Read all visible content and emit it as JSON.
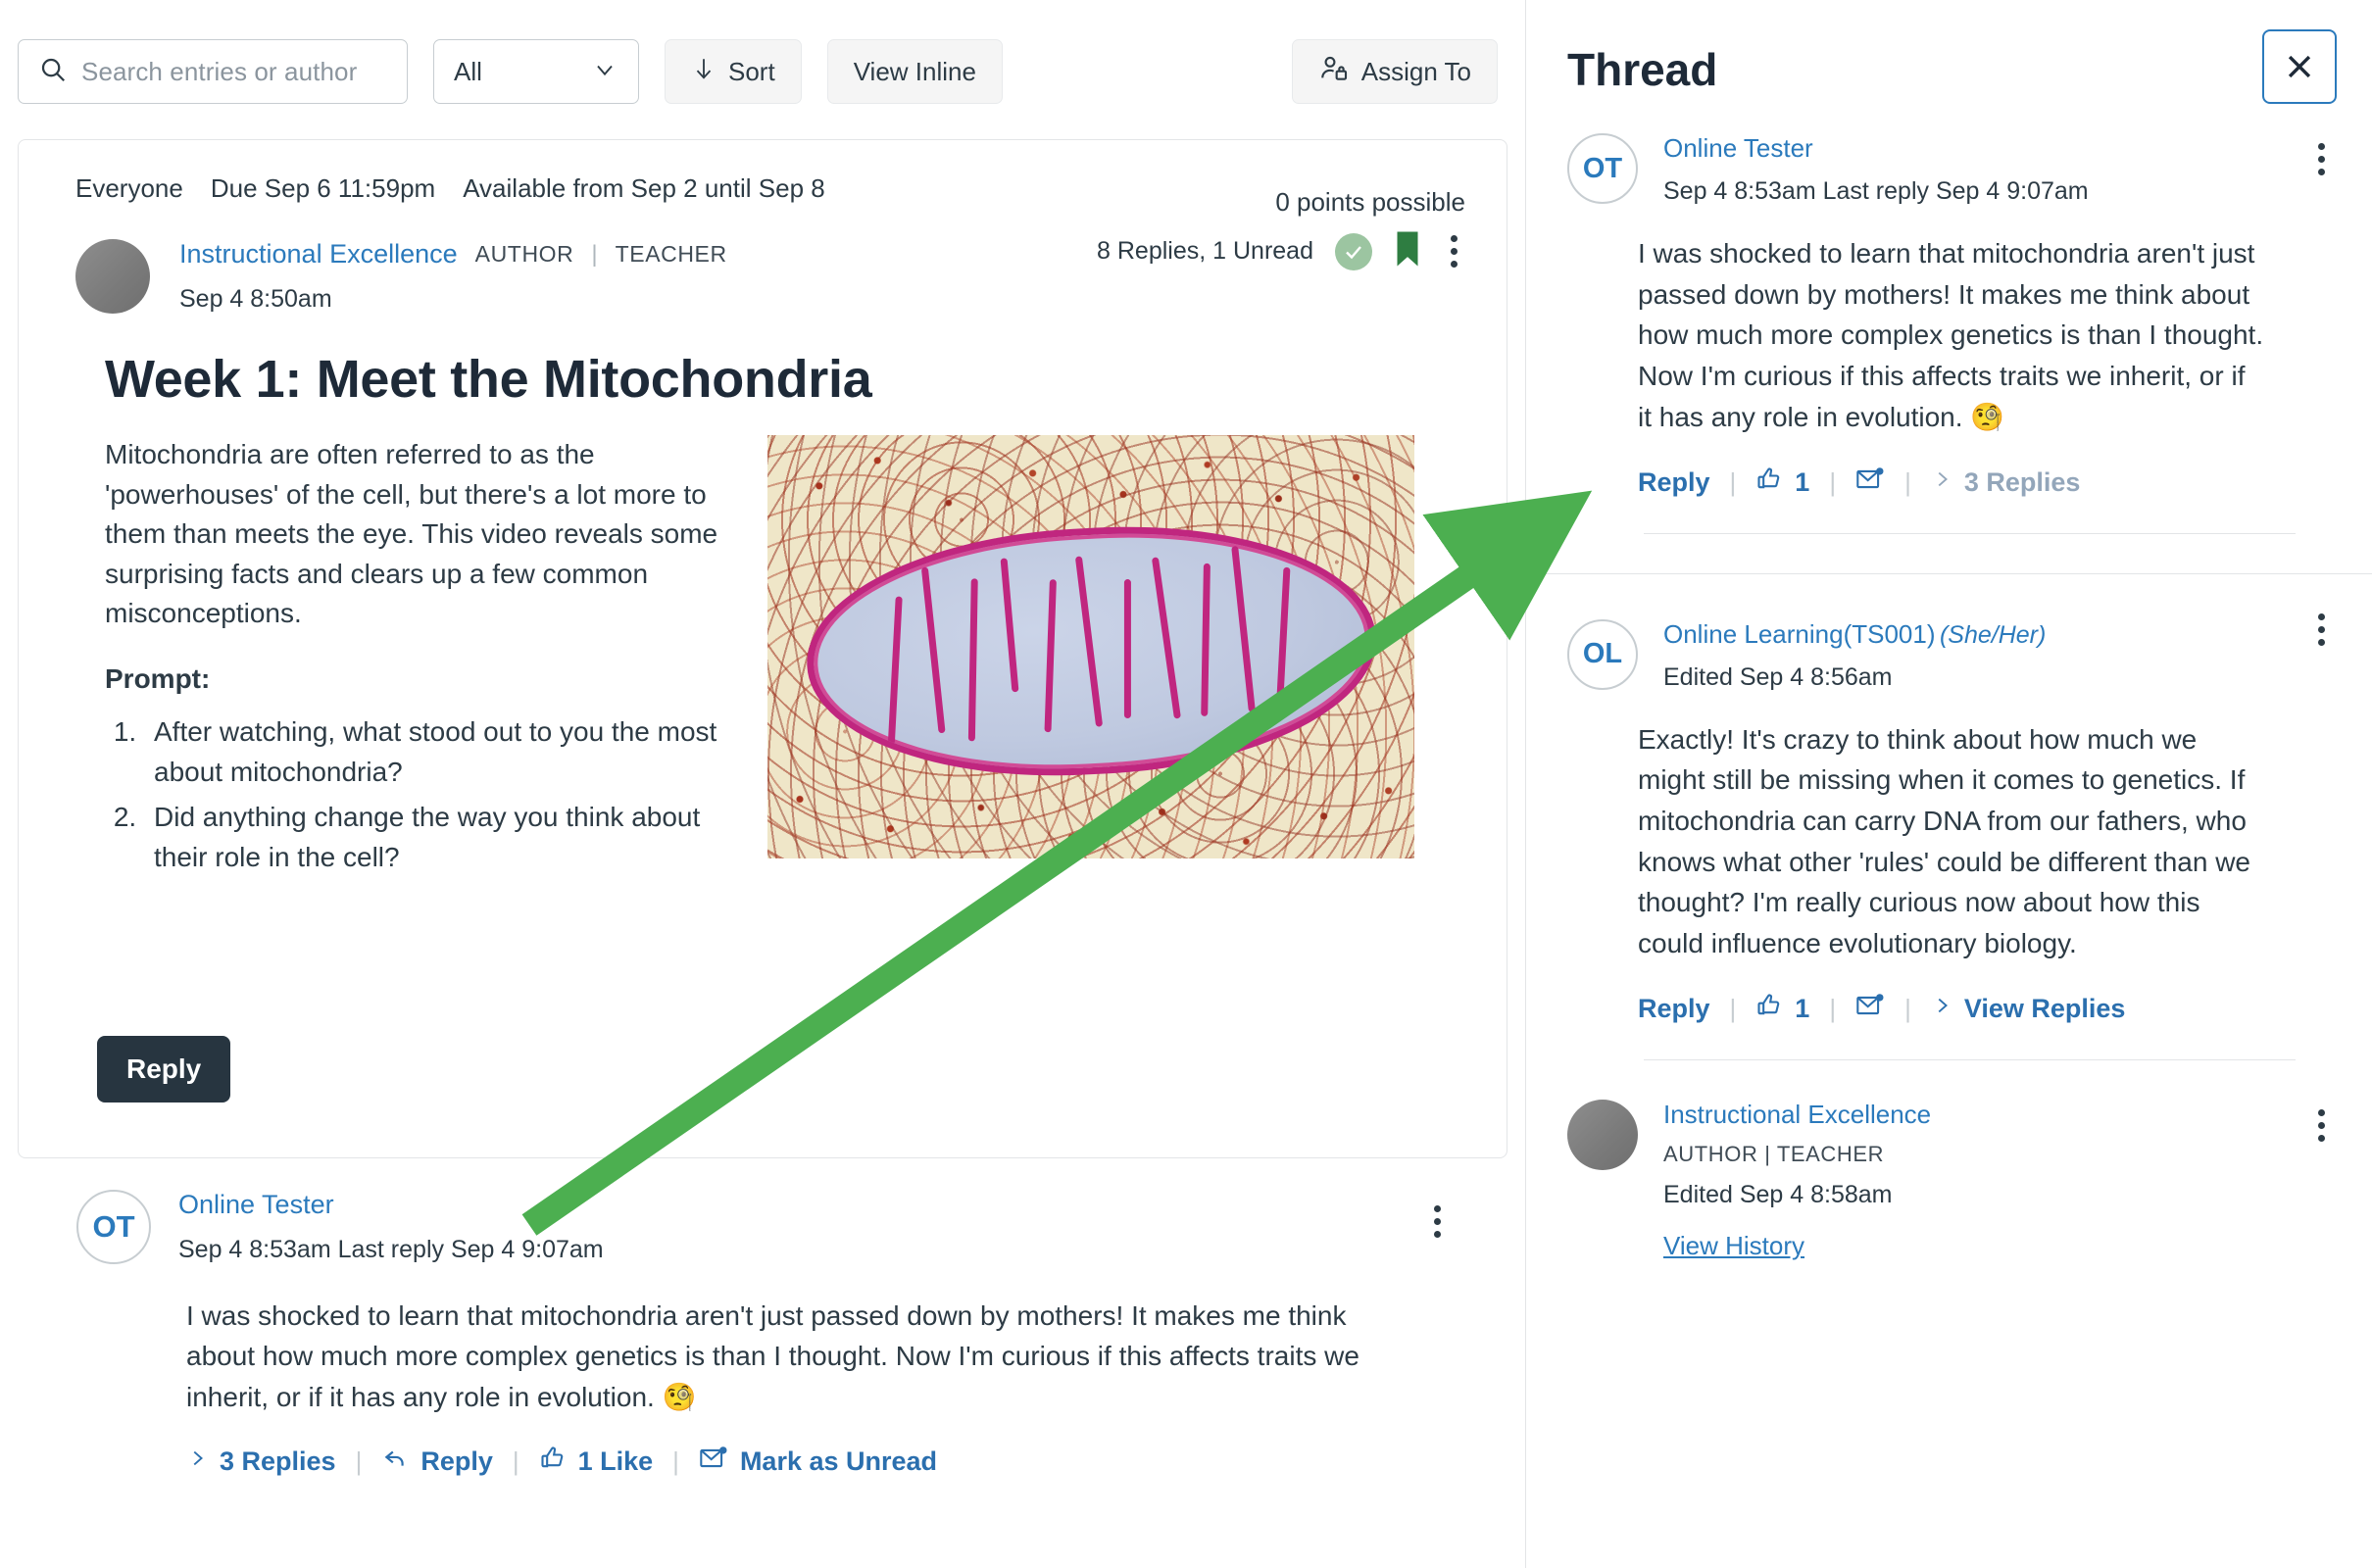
{
  "toolbar": {
    "search_placeholder": "Search entries or author",
    "search_value": "",
    "filter_selected": "All",
    "sort_label": "Sort",
    "view_inline_label": "View Inline",
    "assign_to_label": "Assign To",
    "search_icon": "search-icon",
    "chevron_icon": "chevron-down-icon",
    "sort_icon": "arrow-down-icon",
    "assign_icon": "assign-user-icon"
  },
  "discussion": {
    "audience": "Everyone",
    "due": "Due Sep 6 11:59pm",
    "available": "Available from Sep 2 until Sep 8",
    "points": "0 points possible",
    "author": "Instructional Excellence",
    "author_badge_1": "AUTHOR",
    "author_badge_sep": "|",
    "author_badge_2": "TEACHER",
    "timestamp": "Sep 4 8:50am",
    "replies_summary": "8 Replies, 1 Unread",
    "read_icon": "check-circle-icon",
    "bookmark_icon": "bookmark-icon",
    "kebab_icon": "kebab-menu-icon",
    "title": "Week 1: Meet the Mitochondria",
    "paragraph": "Mitochondria are often referred to as the 'powerhouses' of the cell, but there's a lot more to them than meets the eye. This video reveals some surprising facts and clears up a few common misconceptions.",
    "prompt_label": "Prompt:",
    "prompt_items": [
      "After watching, what stood out to you the most about mitochondria?",
      "Did anything change the way you think about their role in the cell?"
    ],
    "image_alt": "mitochondria-micrograph",
    "reply_button": "Reply"
  },
  "entry": {
    "avatar_initials": "OT",
    "author": "Online Tester",
    "timestamp": "Sep 4 8:53am  Last reply Sep 4 9:07am",
    "text": "I was shocked to learn that mitochondria aren't just passed down by mothers! It makes me think about how much more complex genetics is than I thought. Now I'm curious if this affects traits we inherit, or if it has any role in evolution. 🧐",
    "kebab_icon": "kebab-menu-icon",
    "actions": {
      "replies": "3 Replies",
      "reply": "Reply",
      "like": "1 Like",
      "mark_unread": "Mark as Unread",
      "expand_icon": "chevron-right-icon",
      "reply_icon": "reply-arrow-icon",
      "like_icon": "thumbs-up-icon",
      "unread_icon": "envelope-unread-icon",
      "separator": "|"
    }
  },
  "thread": {
    "title": "Thread",
    "close_icon": "close-icon",
    "posts": [
      {
        "avatar_initials": "OT",
        "avatar_type": "initials",
        "author": "Online Tester",
        "pronouns": "",
        "badges": "",
        "timestamp": "Sep 4 8:53am  Last reply Sep 4 9:07am",
        "view_history": "",
        "text": "I was shocked to learn that mitochondria aren't just passed down by mothers! It makes me think about how much more complex genetics is than I thought. Now I'm curious if this affects traits we inherit, or if it has any role in evolution. 🧐",
        "reply_label": "Reply",
        "like_count": "1",
        "replies_label": "3 Replies",
        "replies_muted": true,
        "kebab_icon": "kebab-menu-icon",
        "like_icon": "thumbs-up-icon",
        "unread_icon": "envelope-unread-icon",
        "expand_icon": "chevron-right-icon",
        "separator": "|"
      },
      {
        "avatar_initials": "OL",
        "avatar_type": "initials",
        "author": "Online Learning(TS001)",
        "pronouns": "(She/Her)",
        "badges": "",
        "timestamp": "Edited Sep 4 8:56am",
        "view_history": "",
        "text": "Exactly! It's crazy to think about how much we might still be missing when it comes to genetics. If mitochondria can carry DNA from our fathers, who knows what other 'rules' could be different than we thought? I'm really curious now about how this could influence evolutionary biology.",
        "reply_label": "Reply",
        "like_count": "1",
        "replies_label": "View Replies",
        "replies_muted": false,
        "kebab_icon": "kebab-menu-icon",
        "like_icon": "thumbs-up-icon",
        "unread_icon": "envelope-unread-icon",
        "expand_icon": "chevron-right-icon",
        "separator": "|"
      },
      {
        "avatar_initials": "",
        "avatar_type": "photo",
        "author": "Instructional Excellence",
        "pronouns": "",
        "badges": "AUTHOR  |  TEACHER",
        "timestamp": "Edited Sep 4 8:58am",
        "view_history": "View History",
        "text": "",
        "reply_label": "",
        "like_count": "",
        "replies_label": "",
        "replies_muted": false,
        "kebab_icon": "kebab-menu-icon",
        "like_icon": "thumbs-up-icon",
        "unread_icon": "envelope-unread-icon",
        "expand_icon": "chevron-right-icon",
        "separator": "|"
      }
    ]
  },
  "annotation": {
    "arrow_color": "#4CAF50",
    "arrow_name": "green-pointer-arrow"
  },
  "colors": {
    "link": "#2B7ABC",
    "primary_button": "#273540",
    "accent_green": "#4CAF50",
    "bookmark_green": "#2E7D41",
    "text": "#2D3B45"
  }
}
